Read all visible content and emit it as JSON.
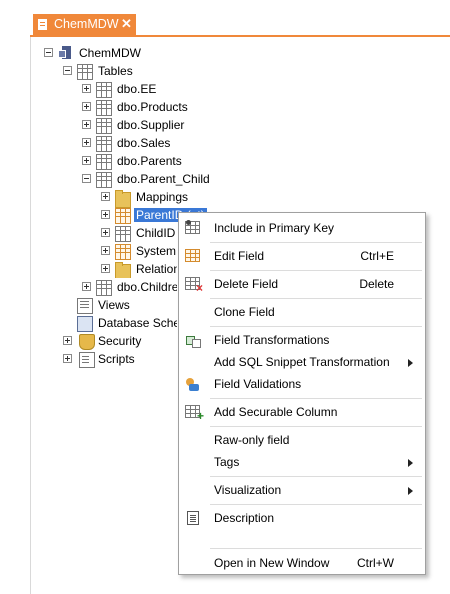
{
  "tab": {
    "title": "ChemMDW",
    "close": "✕"
  },
  "tree": {
    "root": "ChemMDW",
    "tables": "Tables",
    "items": [
      "dbo.EE",
      "dbo.Products",
      "dbo.Supplier",
      "dbo.Sales",
      "dbo.Parents",
      "dbo.Parent_Child"
    ],
    "parent_child_children": [
      "Mappings",
      "ParentID (nt)",
      "ChildID (i",
      "System F",
      "Relations"
    ],
    "after_items": [
      "dbo.Children"
    ],
    "views": "Views",
    "database_schema": "Database Schem",
    "security": "Security",
    "scripts": "Scripts"
  },
  "menu": {
    "include_pk": "Include in Primary Key",
    "edit_field": "Edit Field",
    "edit_field_shortcut": "Ctrl+E",
    "delete_field": "Delete Field",
    "delete_field_shortcut": "Delete",
    "clone_field": "Clone Field",
    "field_transformations": "Field Transformations",
    "add_sql_snippet": "Add SQL Snippet Transformation",
    "field_validations": "Field Validations",
    "add_securable_column": "Add Securable Column",
    "raw_only_field": "Raw-only field",
    "tags": "Tags",
    "visualization": "Visualization",
    "description": "Description",
    "open_new_window": "Open in New Window",
    "open_new_window_shortcut": "Ctrl+W"
  },
  "colors": {
    "accent": "#f0883a",
    "selection": "#3a78d6"
  }
}
